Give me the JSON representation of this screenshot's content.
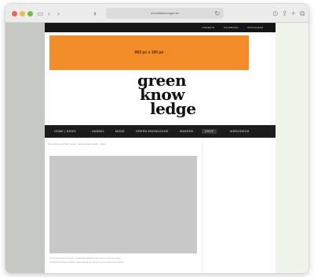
{
  "browser": {
    "url": "a.lookthismooger.se",
    "nav_back_icon": "chevron-left-icon",
    "nav_forward_icon": "chevron-right-icon"
  },
  "site": {
    "top_links": [
      "LINKEDIN",
      "FACEBOOK",
      "INSTAGRAM"
    ],
    "banner_text": "960 px x 180 px",
    "logo": {
      "line1": "green",
      "line2": "know",
      "line3": "ledge"
    },
    "nav": [
      {
        "label": "HOME | NEWS",
        "active": false
      },
      {
        "label": "HANDEL",
        "active": false
      },
      {
        "label": "MODE",
        "active": false
      },
      {
        "label": "GREEN KNOWLEDGE",
        "active": false
      },
      {
        "label": "MARKEN",
        "active": false
      },
      {
        "label": "SHOP",
        "active": true
      },
      {
        "label": "WEBVIDEOS",
        "active": false
      }
    ],
    "breadcrumb": "Sie befinden sich hier: Home > Grüne Mode Fakten > Shop",
    "caption_line1": "Lorem ipsum dolor sit amet, consectetur adipiscing elit, sed do eiusmod tempor",
    "caption_line2": "incididunt ut labore et dolore magna aliqua. Ut enim ad minim veniam quis nostrud"
  },
  "colors": {
    "banner": "#f28c28",
    "nav_bg": "#1c1c1c",
    "placeholder": "#c8c8c8"
  }
}
